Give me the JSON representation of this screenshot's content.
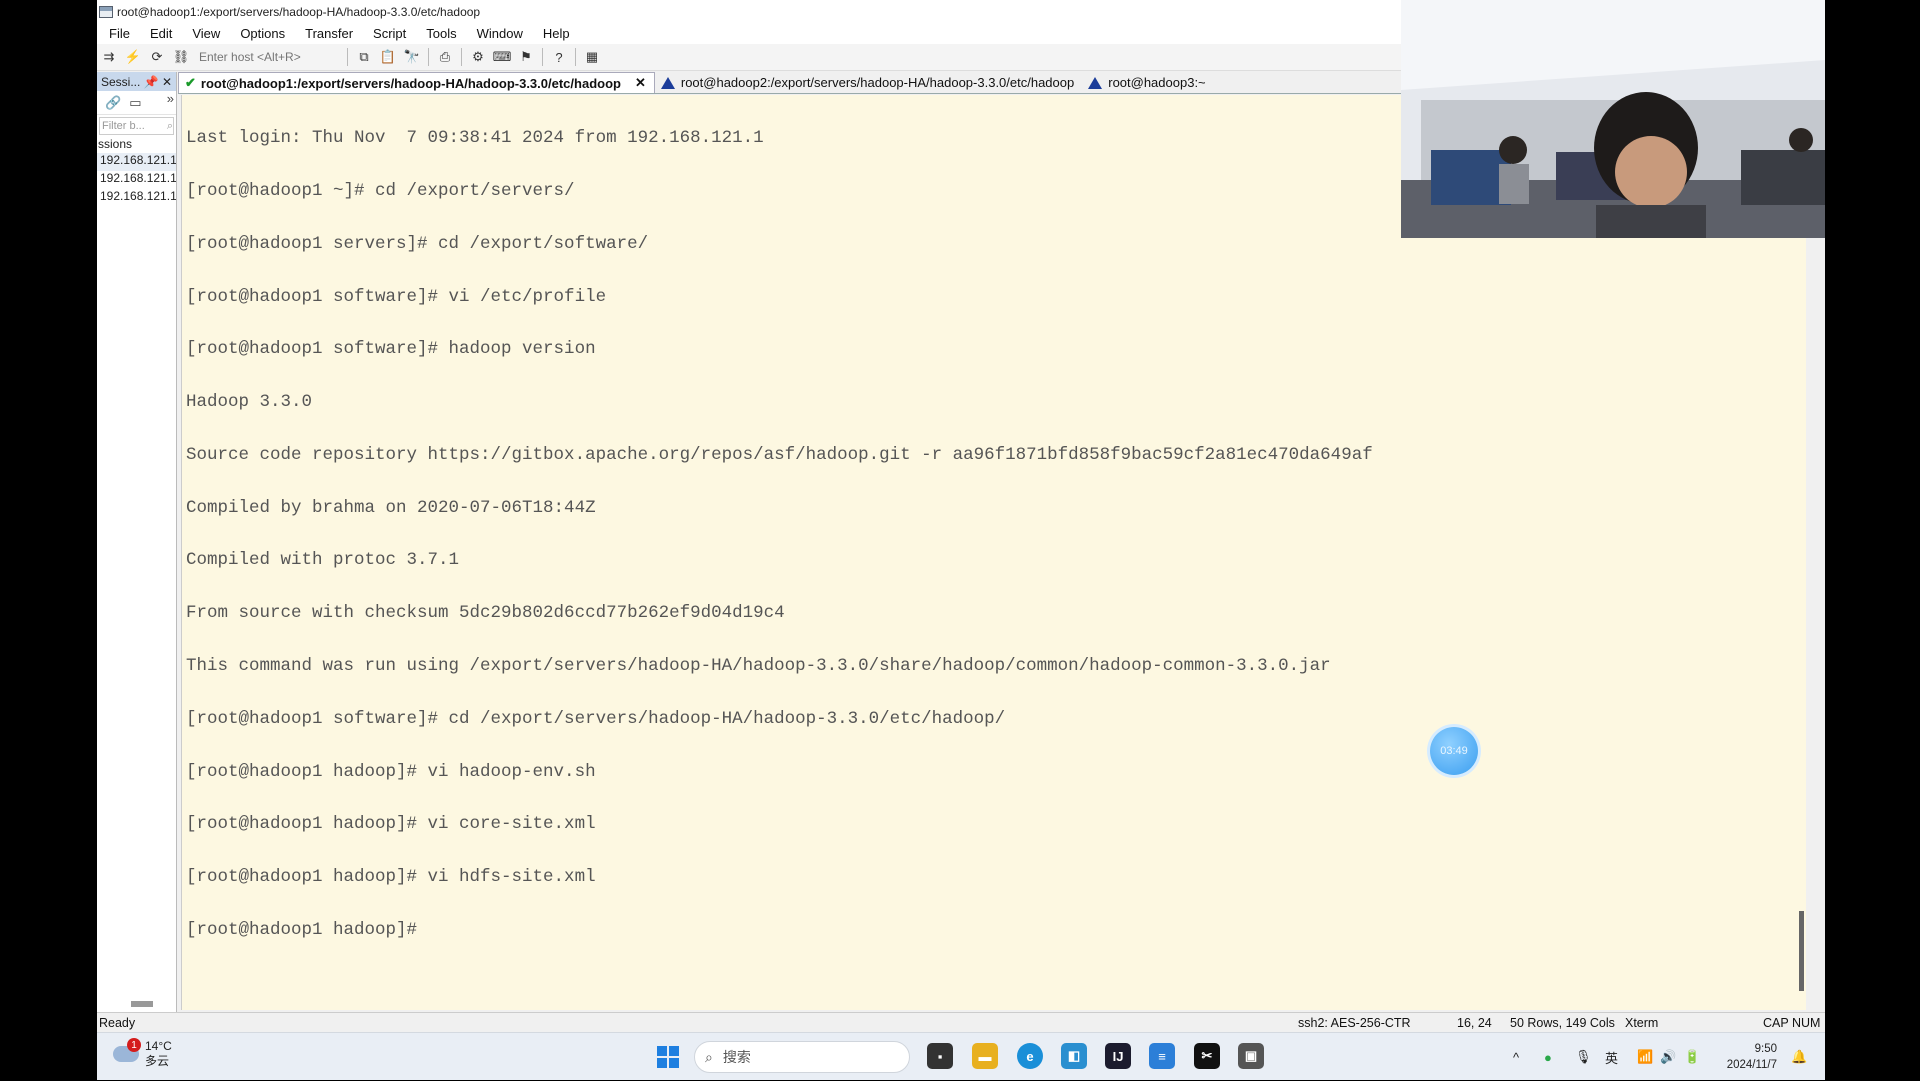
{
  "window": {
    "title": "root@hadoop1:/export/servers/hadoop-HA/hadoop-3.3.0/etc/hadoop"
  },
  "menu": [
    "File",
    "Edit",
    "View",
    "Options",
    "Transfer",
    "Script",
    "Tools",
    "Window",
    "Help"
  ],
  "toolbar": {
    "host_placeholder": "Enter host <Alt+R>"
  },
  "sessions": {
    "header": "Sessi...",
    "filter_placeholder": "Filter b...",
    "label": "ssions",
    "items": [
      "192.168.121.1",
      "192.168.121.1",
      "192.168.121.1"
    ]
  },
  "tabs": [
    {
      "label": "root@hadoop1:/export/servers/hadoop-HA/hadoop-3.3.0/etc/hadoop",
      "status": "connected",
      "active": true
    },
    {
      "label": "root@hadoop2:/export/servers/hadoop-HA/hadoop-3.3.0/etc/hadoop",
      "status": "warning",
      "active": false
    },
    {
      "label": "root@hadoop3:~",
      "status": "warning",
      "active": false
    }
  ],
  "terminal": {
    "lines": [
      "Last login: Thu Nov  7 09:38:41 2024 from 192.168.121.1",
      "[root@hadoop1 ~]# cd /export/servers/",
      "[root@hadoop1 servers]# cd /export/software/",
      "[root@hadoop1 software]# vi /etc/profile",
      "[root@hadoop1 software]# hadoop version",
      "Hadoop 3.3.0",
      "Source code repository https://gitbox.apache.org/repos/asf/hadoop.git -r aa96f1871bfd858f9bac59cf2a81ec470da649af",
      "Compiled by brahma on 2020-07-06T18:44Z",
      "Compiled with protoc 3.7.1",
      "From source with checksum 5dc29b802d6ccd77b262ef9d04d19c4",
      "This command was run using /export/servers/hadoop-HA/hadoop-3.3.0/share/hadoop/common/hadoop-common-3.3.0.jar",
      "[root@hadoop1 software]# cd /export/servers/hadoop-HA/hadoop-3.3.0/etc/hadoop/",
      "[root@hadoop1 hadoop]# vi hadoop-env.sh",
      "[root@hadoop1 hadoop]# vi core-site.xml",
      "[root@hadoop1 hadoop]# vi hdfs-site.xml",
      "[root@hadoop1 hadoop]#"
    ]
  },
  "status": {
    "ready": "Ready",
    "cipher": "ssh2: AES-256-CTR",
    "cursor": "16, 24",
    "size": "50 Rows, 149 Cols",
    "emulation": "Xterm",
    "locks": "CAP NUM"
  },
  "overlay": {
    "timer": "03:49"
  },
  "taskbar": {
    "weather_temp": "14°C",
    "weather_desc": "多云",
    "weather_badge": "1",
    "search_placeholder": "搜索",
    "ime": "英",
    "time": "9:50",
    "date": "2024/11/7"
  },
  "colors": {
    "terminal_bg": "#fdf8e1",
    "terminal_fg": "#555555",
    "tab_ok": "#1a9a2a",
    "tab_warn": "#1c3d9a"
  }
}
